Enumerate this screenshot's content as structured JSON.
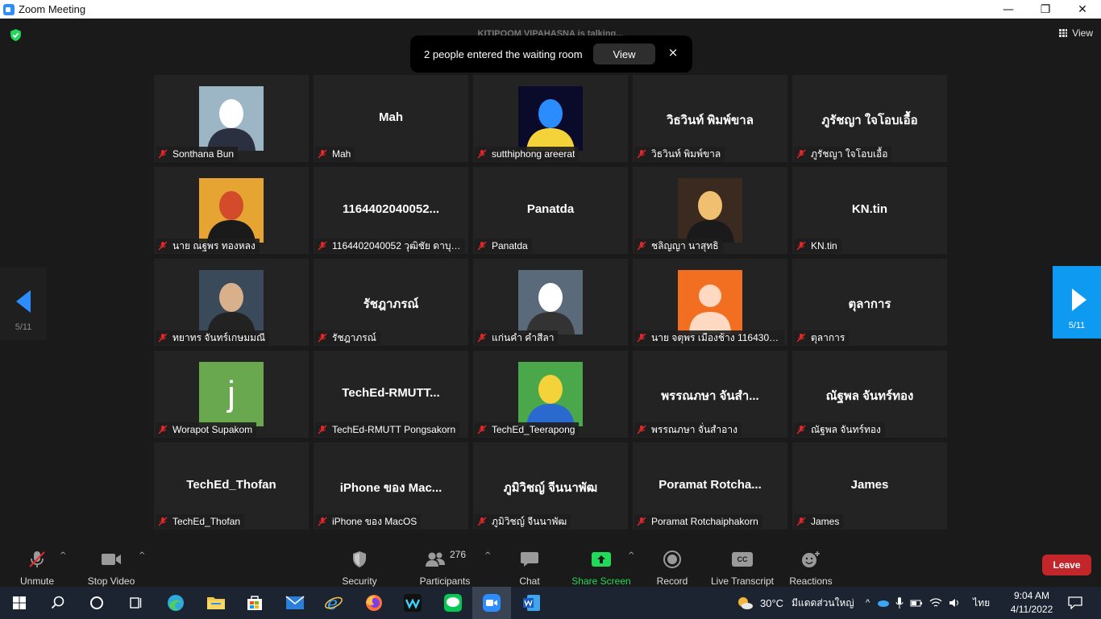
{
  "window": {
    "title": "Zoom Meeting",
    "minimize": "—",
    "maximize": "❐",
    "close": "✕"
  },
  "header": {
    "talking_banner": "KITIPOOM VIPAHASNA is talking...",
    "view_label": "View"
  },
  "waiting_room": {
    "message": "2 people entered the waiting room",
    "view_button": "View",
    "close": "×"
  },
  "pagination": {
    "left": "5/11",
    "right": "5/11"
  },
  "participants": [
    {
      "display": "",
      "label": "Sonthana Bun",
      "avatar": "photo"
    },
    {
      "display": "Mah",
      "label": "Mah"
    },
    {
      "display": "",
      "label": "sutthiphong areerat",
      "avatar": "photo"
    },
    {
      "display": "วิธวินท์ พิมพ์ขาล",
      "label": "วิธวินท์ พิมพ์ขาล"
    },
    {
      "display": "ภูรัชญา ใจโอบเอื้อ",
      "label": "ภูรัชญา ใจโอบเอื้อ"
    },
    {
      "display": "",
      "label": "นาย ณฐพร ทองหลง",
      "avatar": "photo"
    },
    {
      "display": "1164402040052...",
      "label": "1164402040052 วุฒิชัย ดาบุตร"
    },
    {
      "display": "Panatda",
      "label": "Panatda"
    },
    {
      "display": "",
      "label": "ชลิญญา นาสุทธิ",
      "avatar": "photo"
    },
    {
      "display": "KN.tin",
      "label": "KN.tin"
    },
    {
      "display": "",
      "label": "ทยาทร จันทร์เกษมมณี",
      "avatar": "photo"
    },
    {
      "display": "รัชฎาภรณ์",
      "label": "รัชฎาภรณ์"
    },
    {
      "display": "",
      "label": "แก่นคำ คำสีลา",
      "avatar": "photo"
    },
    {
      "display": "",
      "label": "นาย จตุพร เมืองช้าง 1164302...",
      "avatar": "default"
    },
    {
      "display": "ตุลาการ",
      "label": "ตุลาการ"
    },
    {
      "display": "",
      "label": "Worapot Supakom",
      "avatar": "letter",
      "letter": "j"
    },
    {
      "display": "TechEd-RMUTT...",
      "label": "TechEd-RMUTT Pongsakorn"
    },
    {
      "display": "",
      "label": "TechEd_Teerapong",
      "avatar": "photo"
    },
    {
      "display": "พรรณภษา จันสำ...",
      "label": "พรรณภษา จั่นสำอาง"
    },
    {
      "display": "ณัฐพล จันทร์ทอง",
      "label": "ณัฐพล จันทร์ทอง"
    },
    {
      "display": "TechEd_Thofan",
      "label": "TechEd_Thofan"
    },
    {
      "display": "iPhone ของ Mac...",
      "label": "iPhone ของ MacOS"
    },
    {
      "display": "ภูมิวิชญ์ จีนนาพัฒ",
      "label": "ภูมิวิชญ์ จีนนาพัฒ"
    },
    {
      "display": "Poramat Rotcha...",
      "label": "Poramat Rotchaiphakorn"
    },
    {
      "display": "James",
      "label": "James"
    }
  ],
  "toolbar": {
    "unmute": "Unmute",
    "stop_video": "Stop Video",
    "security": "Security",
    "participants": "Participants",
    "participants_count": "276",
    "chat": "Chat",
    "share_screen": "Share Screen",
    "record": "Record",
    "live_transcript": "Live Transcript",
    "cc": "CC",
    "reactions": "Reactions",
    "leave": "Leave"
  },
  "taskbar": {
    "weather_temp": "30°C",
    "weather_text": "มีแดดส่วนใหญ่",
    "language": "ไทย",
    "time": "9:04 AM",
    "date": "4/11/2022"
  },
  "colors": {
    "accent_blue": "#0e9af1",
    "share_green": "#23d959",
    "leave_red": "#c3262a",
    "mute_red": "#e02828"
  }
}
